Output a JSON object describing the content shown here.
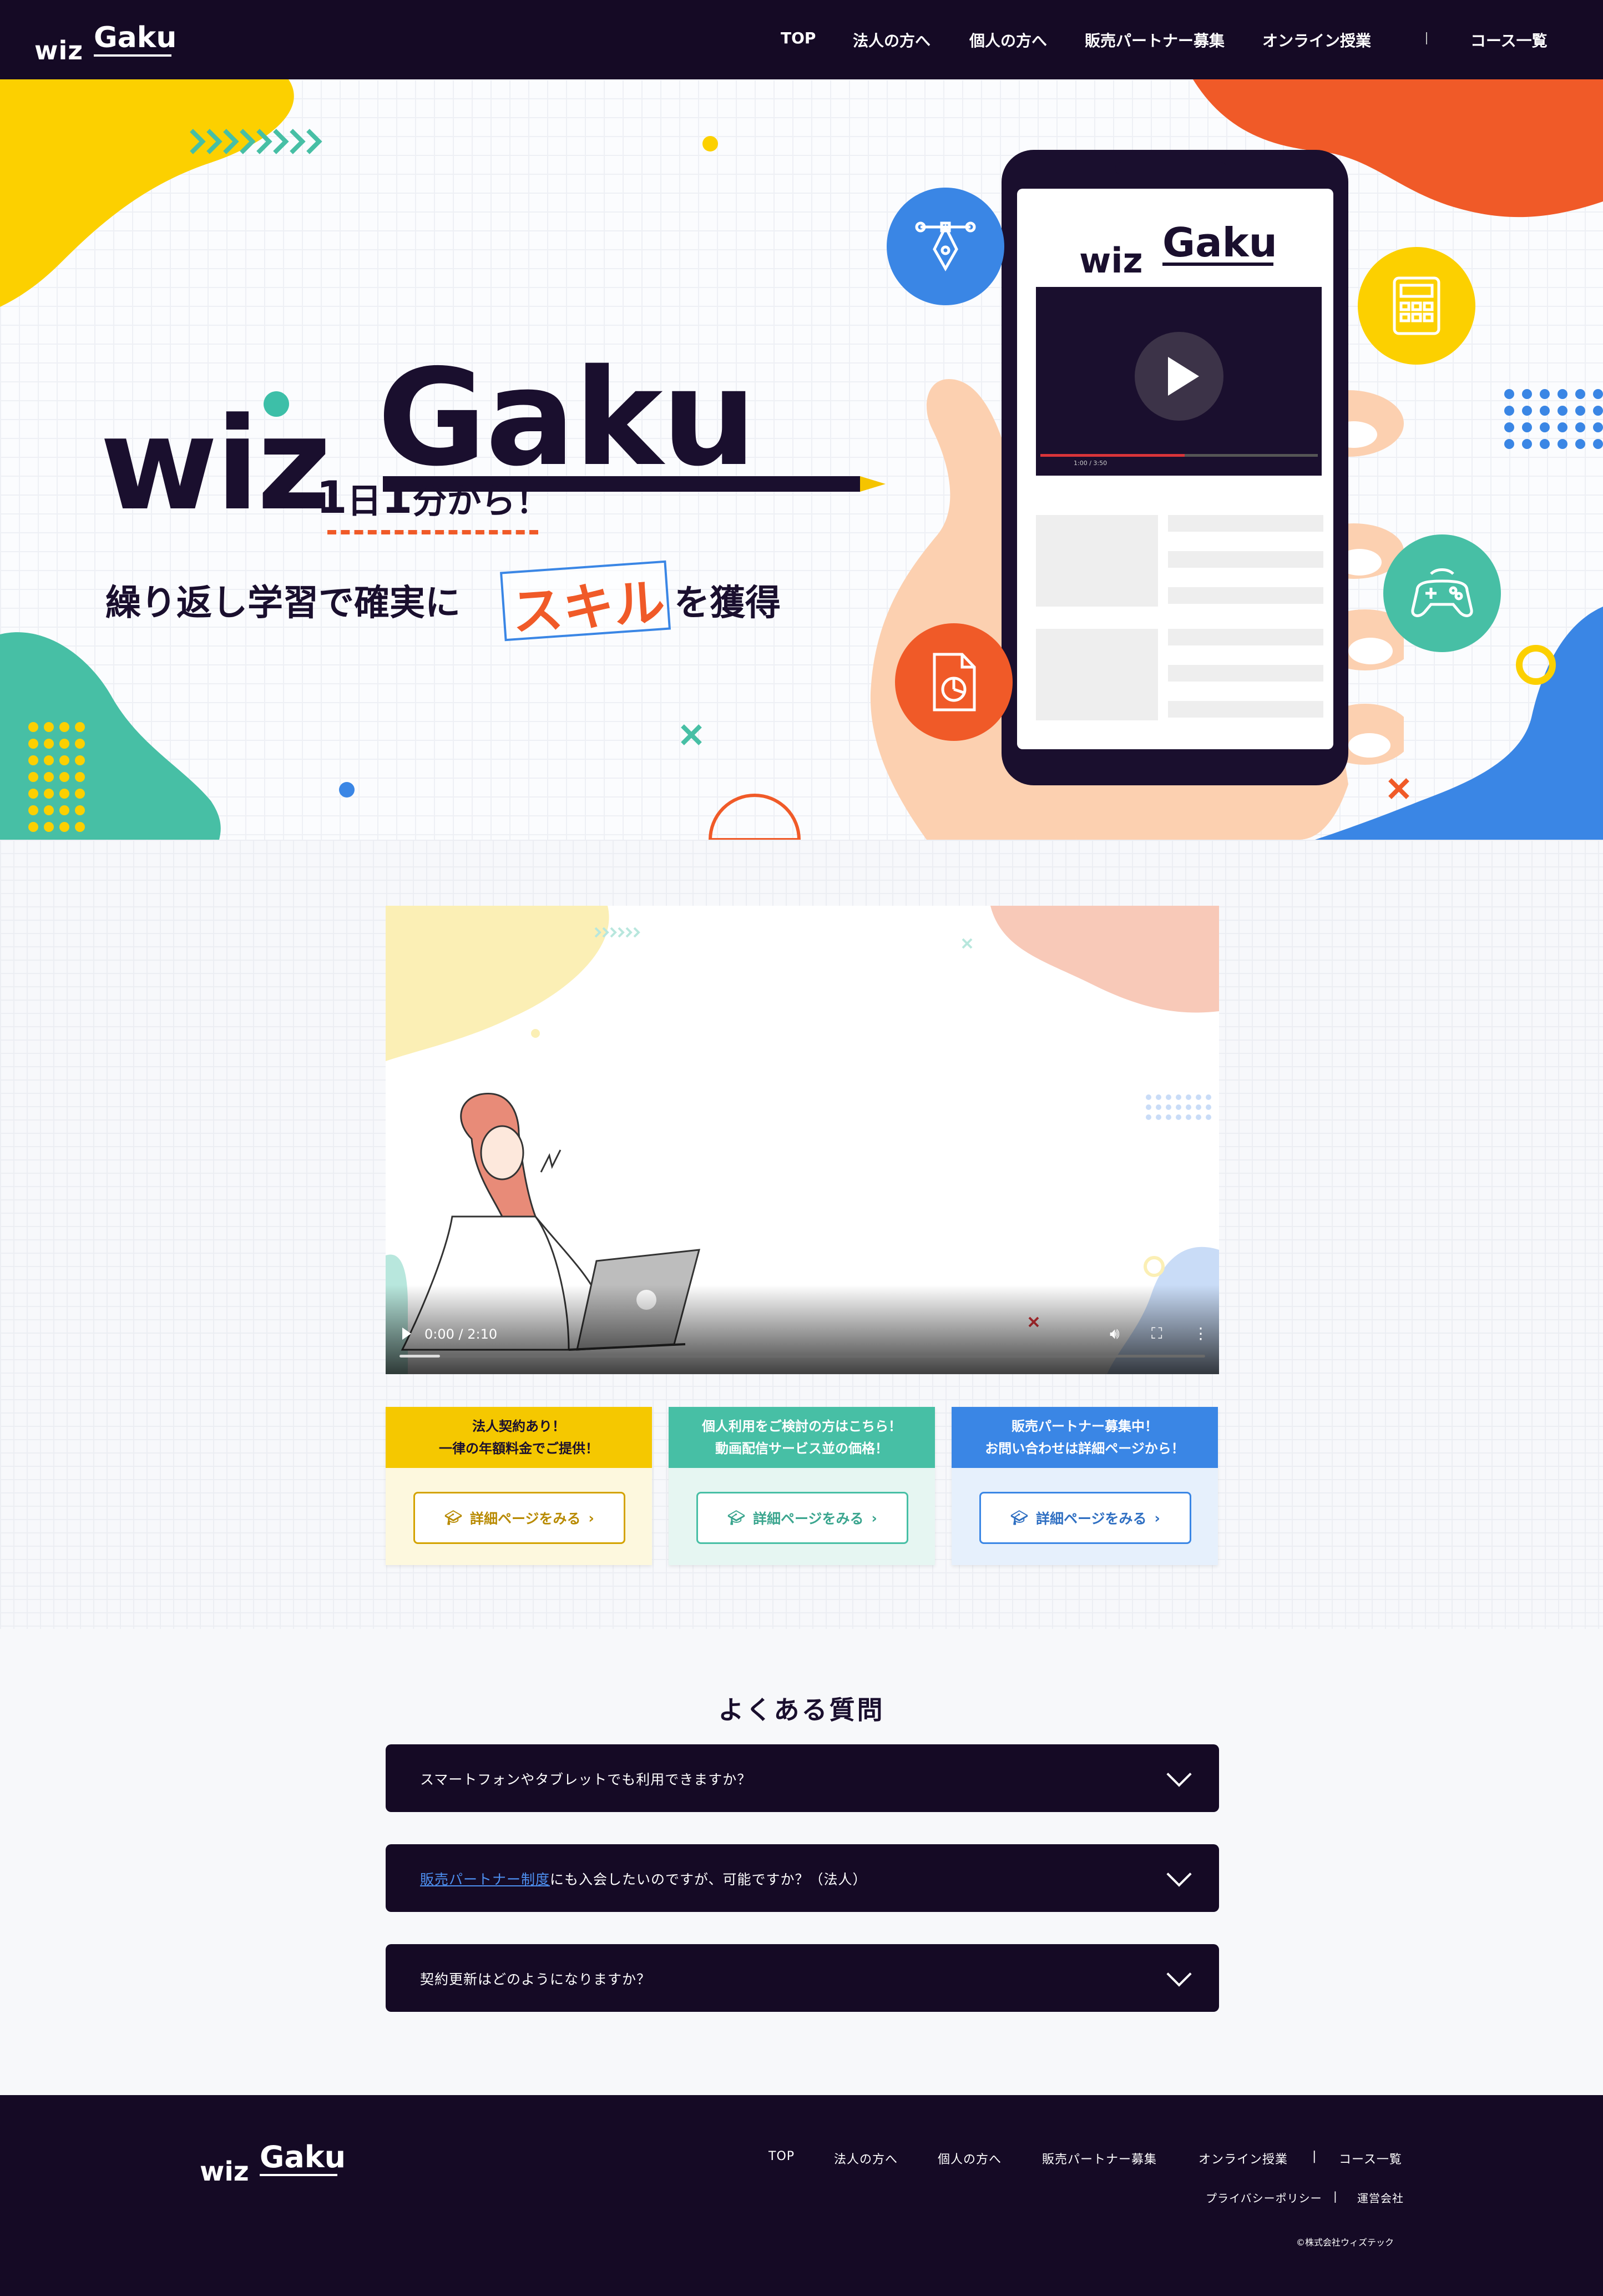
{
  "brand": {
    "wiz": "wiz",
    "gaku": "Gaku"
  },
  "header": {
    "nav": [
      "TOP",
      "法人の方へ",
      "個人の方へ",
      "販売パートナー募集",
      "オンライン授業",
      "コース一覧"
    ],
    "separator": "|"
  },
  "hero": {
    "tagline_line1": {
      "n1": "1",
      "day": "日",
      "n2": "1",
      "rest": "分から！"
    },
    "tagline_line2_before": "繰り返し学習で確実に",
    "tagline_highlight": "スキル",
    "tagline_line2_after": "を獲得",
    "phone_time": "1:00 / 3:50",
    "icons": [
      "pen-tool-icon",
      "calculator-icon",
      "gamepad-icon",
      "document-chart-icon"
    ]
  },
  "video": {
    "time": "0:00 / 2:10",
    "progress": 0.05
  },
  "cards": [
    {
      "line1": "法人契約あり！",
      "line2": "一律の年額料金でご提供！",
      "button": "詳細ページをみる",
      "color": "#f5c800",
      "bg": "#fdf8de"
    },
    {
      "line1": "個人利用をご検討の方はこちら！",
      "line2": "動画配信サービス並の価格！",
      "button": "詳細ページをみる",
      "color": "#47bfa5",
      "bg": "#e6f6f2"
    },
    {
      "line1": "販売パートナー募集中！",
      "line2": "お問い合わせは詳細ページから！",
      "button": "詳細ページをみる",
      "color": "#3a86e5",
      "bg": "#e6f0fc"
    }
  ],
  "faq": {
    "title": "よくある質問",
    "items": [
      {
        "link": "",
        "text": "スマートフォンやタブレットでも利用できますか？"
      },
      {
        "link": "販売パートナー制度",
        "text": "にも入会したいのですが、可能ですか？（法人）"
      },
      {
        "link": "",
        "text": "契約更新はどのようになりますか？"
      }
    ]
  },
  "footer": {
    "nav": [
      "TOP",
      "法人の方へ",
      "個人の方へ",
      "販売パートナー募集",
      "オンライン授業",
      "コース一覧"
    ],
    "separator": "|",
    "sub": [
      "プライバシーポリシー",
      "運営会社"
    ],
    "copyright": "©株式会社ウィズテック"
  },
  "colors": {
    "navy": "#150a25",
    "yellow": "#f5c800",
    "teal": "#47bfa5",
    "blue": "#3a86e5",
    "orange": "#f05a28"
  }
}
